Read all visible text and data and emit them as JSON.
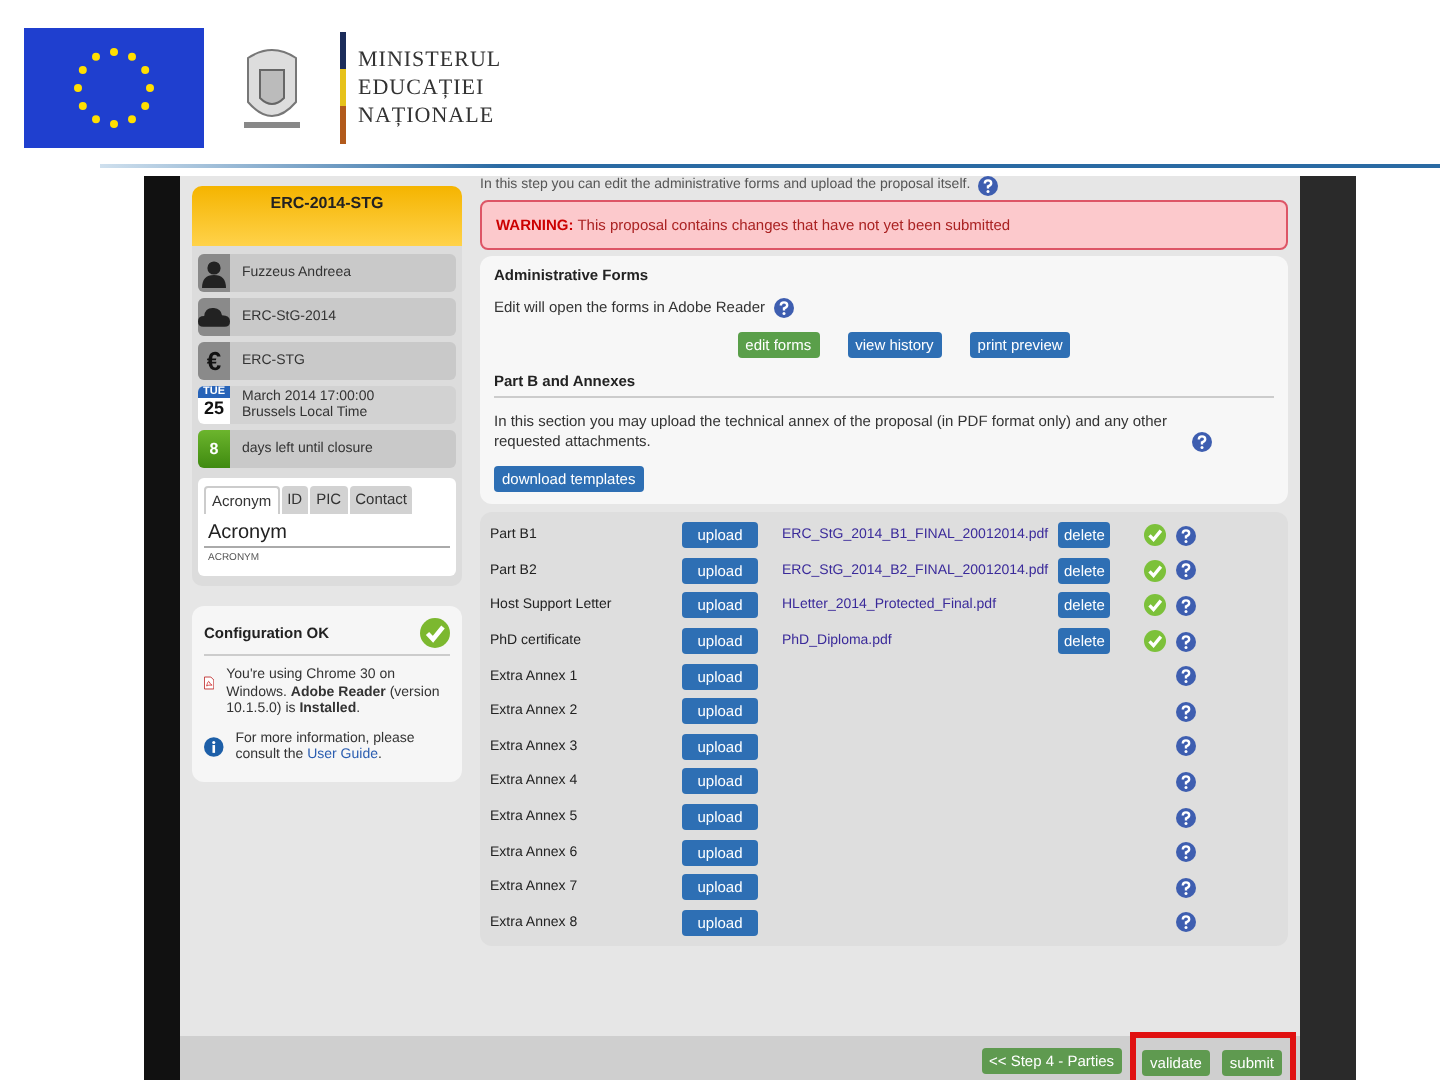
{
  "header": {
    "org_lines": [
      "MINISTERUL",
      "EDUCAȚIEI",
      "NAȚIONALE"
    ]
  },
  "sidebar": {
    "call_title": "ERC-2014-STG",
    "info": [
      {
        "kind": "person",
        "text": "Fuzzeus Andreea"
      },
      {
        "kind": "cloud",
        "text": "ERC-StG-2014"
      },
      {
        "kind": "currency",
        "symbol": "€",
        "text": "ERC-STG"
      },
      {
        "kind": "date",
        "weekday": "TUE",
        "day": "25",
        "text": "March 2014 17:00:00",
        "subtext": "Brussels Local Time"
      },
      {
        "kind": "count",
        "count": "8",
        "text": "days left until closure"
      }
    ],
    "tabs": [
      {
        "label": "Acronym",
        "selected": true
      },
      {
        "label": "ID",
        "selected": false
      },
      {
        "label": "PIC",
        "selected": false
      },
      {
        "label": "Contact",
        "selected": false
      }
    ],
    "acronym_field": {
      "value": "Acronym",
      "caption": "ACRONYM"
    },
    "config": {
      "title": "Configuration OK",
      "message": "You're using Chrome 30 on Windows. **Adobe Reader** (version 10.1.5.0) is **Installed**.",
      "help_text": "For more information, please consult the",
      "help_link": "User Guide",
      "help_end": "."
    }
  },
  "main": {
    "intro": "In this step you can edit the administrative forms and upload the proposal itself.",
    "warning": {
      "label": "WARNING:",
      "text": "This proposal contains changes that have not yet been submitted"
    },
    "admin": {
      "title": "Administrative Forms",
      "text": "Edit will open the forms in Adobe Reader",
      "buttons": [
        {
          "label": "edit forms",
          "kind": "success"
        },
        {
          "label": "view history",
          "kind": "primary"
        },
        {
          "label": "print preview",
          "kind": "primary"
        }
      ]
    },
    "part_b": {
      "title": "Part B and Annexes",
      "text": "In this section you may upload the technical annex of the proposal (in PDF format only) and any other requested attachments.",
      "template_button": "download templates",
      "rows": [
        {
          "label": "Part B1",
          "button": "upload",
          "file": "ERC_StG_2014_B1_FINAL_20012014.pdf",
          "delete": "delete",
          "checked": true
        },
        {
          "label": "Part B2",
          "button": "upload",
          "file": "ERC_StG_2014_B2_FINAL_20012014.pdf",
          "delete": "delete",
          "checked": true
        },
        {
          "label": "Host Support Letter",
          "button": "upload",
          "file": "HLetter_2014_Protected_Final.pdf",
          "delete": "delete",
          "checked": true
        },
        {
          "label": "PhD certificate",
          "button": "upload",
          "file": "PhD_Diploma.pdf",
          "delete": "delete",
          "checked": true
        },
        {
          "label": "Extra Annex 1",
          "button": "upload",
          "checked": false
        },
        {
          "label": "Extra Annex 2",
          "button": "upload",
          "checked": false
        },
        {
          "label": "Extra Annex 3",
          "button": "upload",
          "checked": false
        },
        {
          "label": "Extra Annex 4",
          "button": "upload",
          "checked": false
        },
        {
          "label": "Extra Annex 5",
          "button": "upload",
          "checked": false
        },
        {
          "label": "Extra Annex 6",
          "button": "upload",
          "checked": false
        },
        {
          "label": "Extra Annex 7",
          "button": "upload",
          "checked": false
        },
        {
          "label": "Extra Annex 8",
          "button": "upload",
          "checked": false
        }
      ]
    }
  },
  "footer": {
    "buttons": [
      {
        "label": "<< Step 4 - Parties",
        "highlighted": false
      },
      {
        "label": "validate",
        "highlighted": true
      },
      {
        "label": "submit",
        "highlighted": true
      }
    ]
  }
}
